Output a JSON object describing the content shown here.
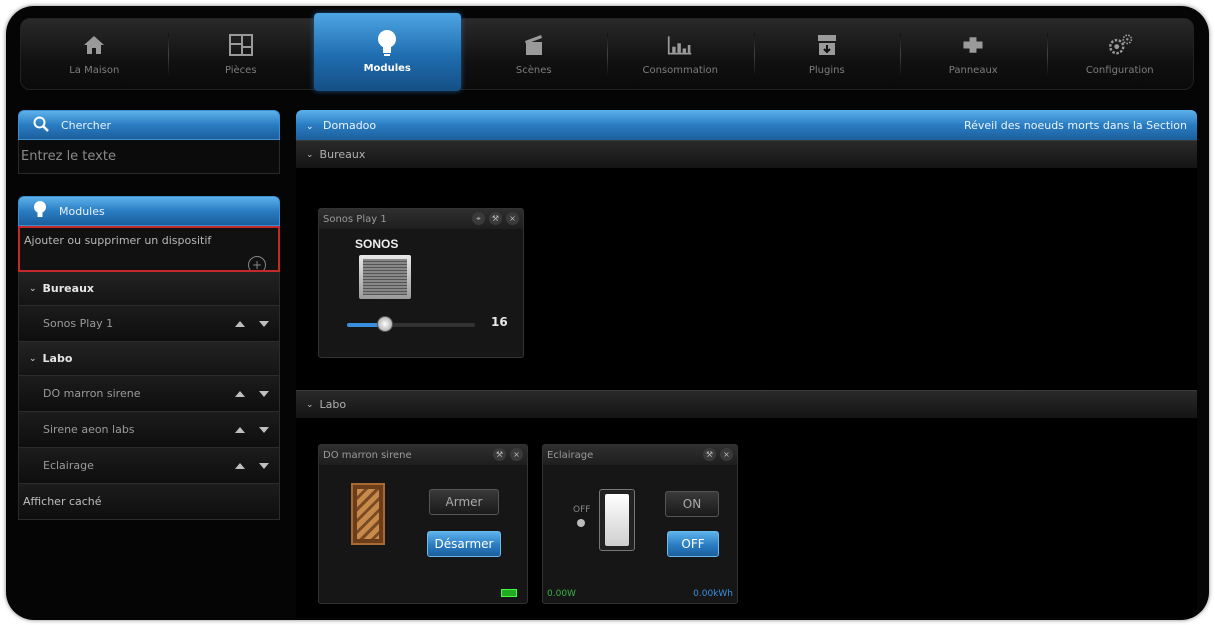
{
  "nav": {
    "tabs": [
      {
        "label": "La Maison",
        "icon": "house-icon"
      },
      {
        "label": "Pièces",
        "icon": "rooms-icon"
      },
      {
        "label": "Modules",
        "icon": "lightbulb-icon",
        "active": true
      },
      {
        "label": "Scènes",
        "icon": "clapperboard-icon"
      },
      {
        "label": "Consommation",
        "icon": "chart-icon"
      },
      {
        "label": "Plugins",
        "icon": "plugin-box-icon"
      },
      {
        "label": "Panneaux",
        "icon": "puzzle-icon"
      },
      {
        "label": "Configuration",
        "icon": "gears-icon"
      }
    ]
  },
  "sidebar": {
    "search": {
      "title": "Chercher",
      "placeholder": "Entrez le texte"
    },
    "modules": {
      "title": "Modules",
      "add_label": "Ajouter ou supprimer un dispositif",
      "groups": [
        {
          "name": "Bureaux",
          "items": [
            "Sonos Play 1"
          ]
        },
        {
          "name": "Labo",
          "items": [
            "DO marron sirene",
            "Sirene aeon labs",
            "Eclairage"
          ]
        }
      ],
      "footer": "Afficher caché"
    }
  },
  "main": {
    "title": "Domadoo",
    "action": "Réveil des noeuds morts dans la Section",
    "sections": [
      {
        "name": "Bureaux",
        "widgets": [
          {
            "title": "Sonos Play 1",
            "brand": "SONOS",
            "volume": 16,
            "volume_fraction": 0.3
          }
        ]
      },
      {
        "name": "Labo",
        "widgets": [
          {
            "title": "DO marron sirene",
            "arm_label": "Armer",
            "disarm_label": "Désarmer"
          },
          {
            "title": "Eclairage",
            "off_indicator": "OFF",
            "on_label": "ON",
            "off_label": "OFF",
            "power": "0.00W",
            "energy": "0.00kWh"
          }
        ]
      }
    ]
  },
  "colors": {
    "accent": "#2a7cc2",
    "highlight_border": "#c42a2a",
    "background": "#050505"
  }
}
